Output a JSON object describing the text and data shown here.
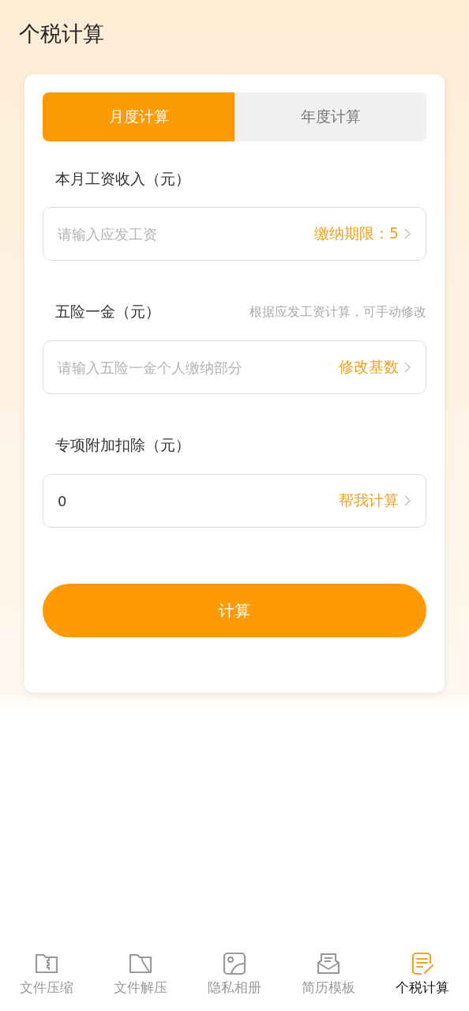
{
  "header": {
    "title": "个税计算"
  },
  "tabs": [
    {
      "label": "月度计算",
      "selected": true
    },
    {
      "label": "年度计算",
      "selected": false
    }
  ],
  "fields": [
    {
      "label": "本月工资收入（元）",
      "placeholder": "请输入应发工资",
      "action": "缴纳期限：5"
    },
    {
      "label": "五险一金（元）",
      "hint": "根据应发工资计算，可手动修改",
      "placeholder": "请输入五险一金个人缴纳部分",
      "action": "修改基数"
    },
    {
      "label": "专项附加扣除（元）",
      "value": "0",
      "action": "帮我计算"
    }
  ],
  "calculate_button": "计算",
  "bottom_nav": [
    {
      "label": "文件压缩",
      "selected": false
    },
    {
      "label": "文件解压",
      "selected": false
    },
    {
      "label": "隐私相册",
      "selected": false
    },
    {
      "label": "简历模板",
      "selected": false
    },
    {
      "label": "个税计算",
      "selected": true
    }
  ]
}
